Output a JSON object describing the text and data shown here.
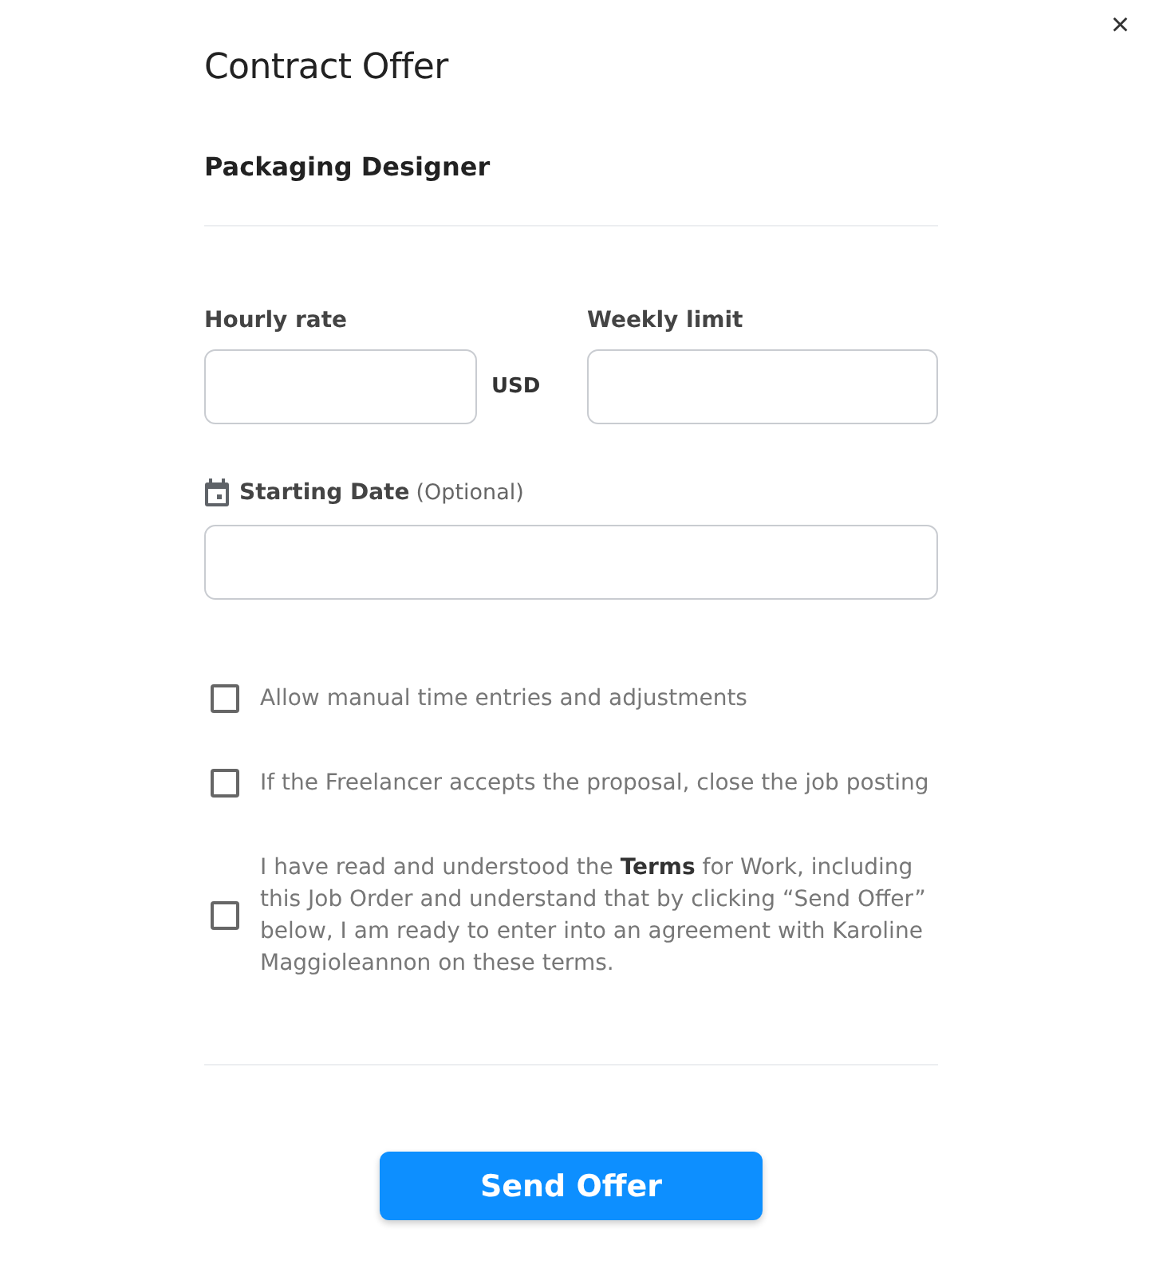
{
  "close": "×",
  "title": "Contract Offer",
  "job_title": "Packaging Designer",
  "rate": {
    "label": "Hourly rate",
    "currency": "USD"
  },
  "limit": {
    "label": "Weekly limit"
  },
  "start_date": {
    "label": "Starting Date",
    "note": "(Optional)"
  },
  "options": [
    {
      "text": "Allow manual time entries and adjustments",
      "checked": false
    },
    {
      "text": "If the Freelancer accepts the proposal, close the job posting",
      "checked": false
    },
    {
      "text": "I have read and understood the **Terms** for Work, including this Job Order and understand that by clicking “Send Offer” below, I am ready to enter into an agreement with Karoline Maggioleannon on these terms.",
      "checked": false
    }
  ],
  "submit": "Send Offer"
}
